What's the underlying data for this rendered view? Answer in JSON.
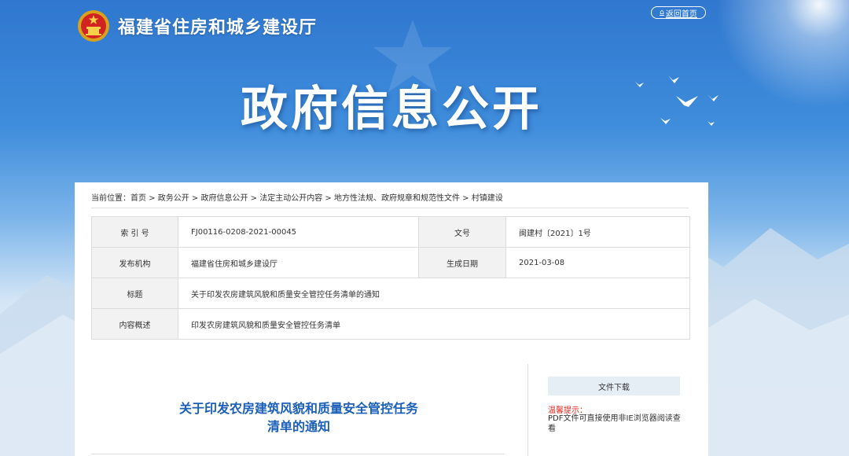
{
  "header": {
    "site_title": "福建省住房和城乡建设厅",
    "home_link": "返回首页",
    "banner_title": "政府信息公开"
  },
  "breadcrumb": {
    "prefix": "当前位置：",
    "items": [
      "首页",
      "政务公开",
      "政府信息公开",
      "法定主动公开内容",
      "地方性法规、政府规章和规范性文件",
      "村镇建设"
    ],
    "separator": " > "
  },
  "info_table": {
    "index_label": "索 引 号",
    "index_value": "FJ00116-0208-2021-00045",
    "docno_label": "文号",
    "docno_value": "闽建村〔2021〕1号",
    "issuer_label": "发布机构",
    "issuer_value": "福建省住房和城乡建设厅",
    "date_label": "生成日期",
    "date_value": "2021-03-08",
    "title_label": "标题",
    "title_value": "关于印发农房建筑风貌和质量安全管控任务清单的通知",
    "summary_label": "内容概述",
    "summary_value": "印发农房建筑风貌和质量安全管控任务清单"
  },
  "document": {
    "title_line1": "关于印发农房建筑风貌和质量安全管控任务",
    "title_line2": "清单的通知"
  },
  "sidebar": {
    "download_button": "文件下载",
    "tip_label": "温馨提示：",
    "tip_text": "PDF文件可直接使用非IE浏览器阅读查看"
  },
  "colors": {
    "sky_top": "#2f77cf",
    "doc_title": "#1b5fb8",
    "tip_red": "#e1251b",
    "label_bg": "#f2f2f2",
    "download_bg": "#e5edf5"
  }
}
